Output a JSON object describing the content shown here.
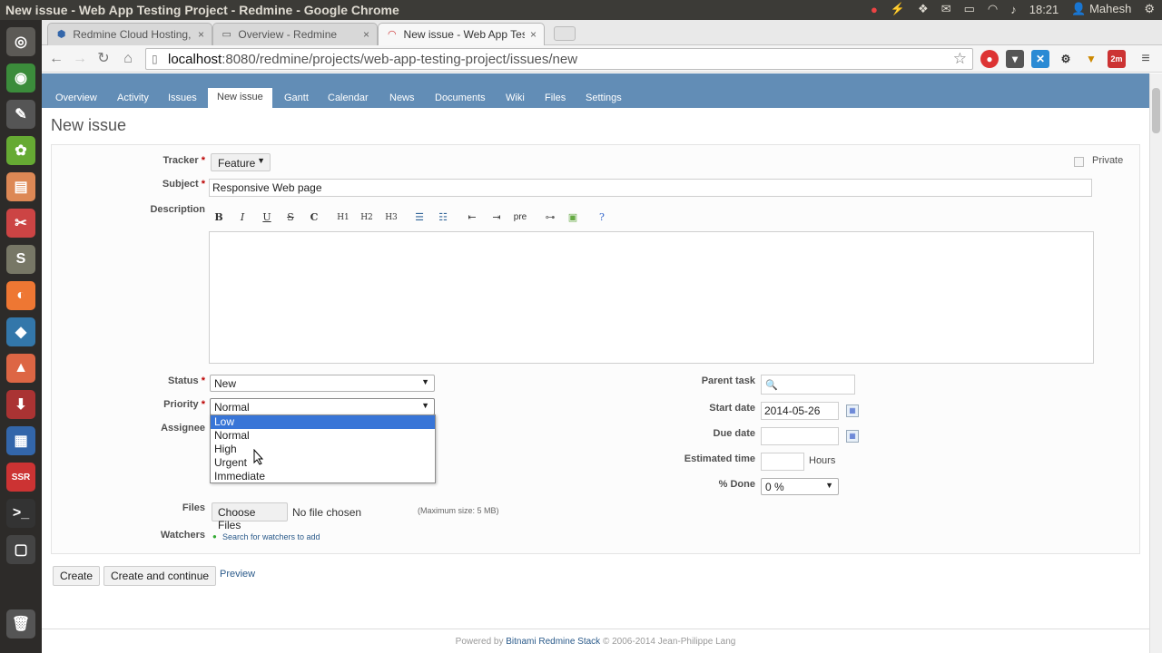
{
  "os": {
    "window_title": "New issue - Web App Testing Project - Redmine - Google Chrome",
    "time": "18:21",
    "user": "Mahesh"
  },
  "browser": {
    "tabs": [
      {
        "label": "Redmine Cloud Hosting, R",
        "active": false
      },
      {
        "label": "Overview - Redmine",
        "active": false
      },
      {
        "label": "New issue - Web App Tes",
        "active": true
      }
    ],
    "url_host": "localhost",
    "url_path": ":8080/redmine/projects/web-app-testing-project/issues/new",
    "extension_badge": "2m"
  },
  "menu": {
    "items": [
      "Overview",
      "Activity",
      "Issues",
      "New issue",
      "Gantt",
      "Calendar",
      "News",
      "Documents",
      "Wiki",
      "Files",
      "Settings"
    ],
    "selected": "New issue"
  },
  "page_title": "New issue",
  "form": {
    "tracker_label": "Tracker",
    "tracker_value": "Feature",
    "private_label": "Private",
    "subject_label": "Subject",
    "subject_value": "Responsive Web page",
    "description_label": "Description",
    "toolbar": [
      "B",
      "I",
      "U",
      "S",
      "C",
      "H1",
      "H2",
      "H3",
      "ul",
      "ol",
      "indent-left",
      "indent-right",
      "pre",
      "link",
      "image",
      "help"
    ],
    "pre_label": "pre",
    "status_label": "Status",
    "status_value": "New",
    "priority_label": "Priority",
    "priority_value": "Normal",
    "priority_options": [
      "Low",
      "Normal",
      "High",
      "Urgent",
      "Immediate"
    ],
    "priority_highlighted": "Low",
    "assignee_label": "Assignee",
    "parent_task_label": "Parent task",
    "start_date_label": "Start date",
    "start_date_value": "2014-05-26",
    "due_date_label": "Due date",
    "estimated_time_label": "Estimated time",
    "hours_label": "Hours",
    "done_label": "% Done",
    "done_value": "0 %",
    "files_label": "Files",
    "choose_files_label": "Choose Files",
    "no_file_label": "No file chosen",
    "max_size_label": "(Maximum size: 5 MB)",
    "watchers_label": "Watchers",
    "watchers_link": "Search for watchers to add"
  },
  "actions": {
    "create": "Create",
    "create_continue": "Create and continue",
    "preview": "Preview"
  },
  "footer": {
    "prefix": "Powered by",
    "link": "Bitnami Redmine Stack",
    "suffix": "© 2006-2014 Jean-Philippe Lang"
  },
  "colors": {
    "menu_bg": "#628db6",
    "dropdown_highlight": "#3875d7",
    "required": "#bb0000"
  }
}
